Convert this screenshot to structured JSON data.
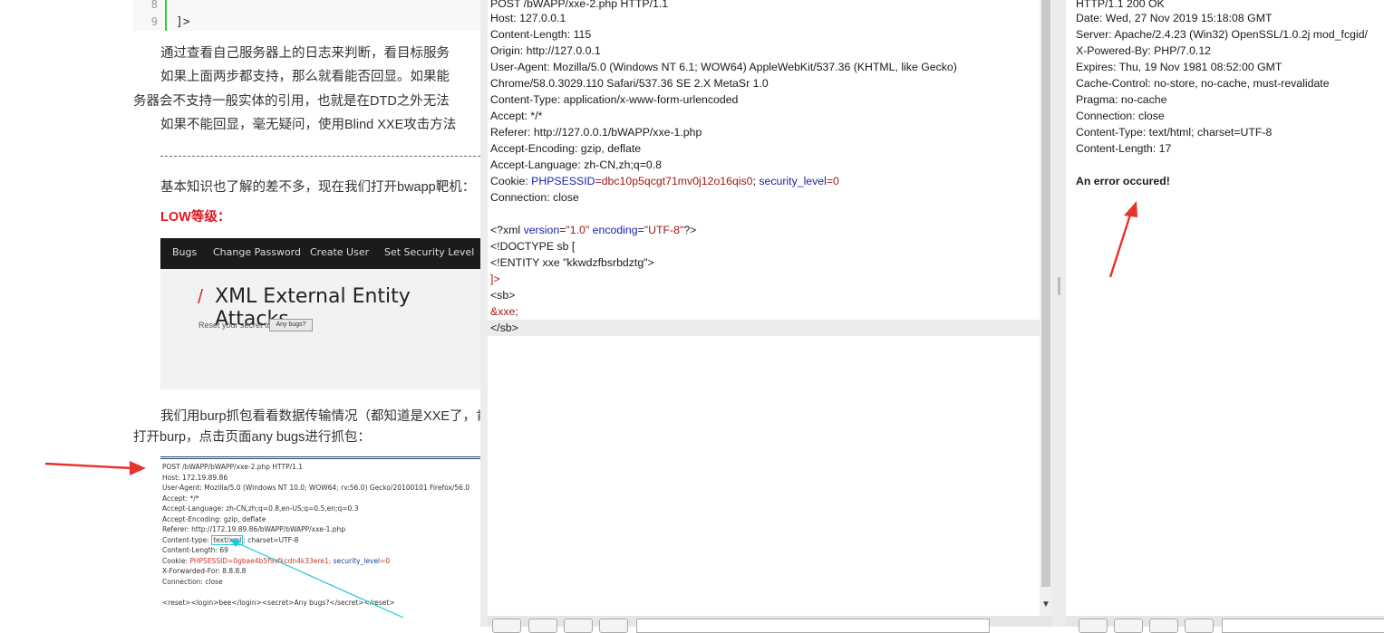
{
  "article": {
    "code_lines": [
      {
        "no": "8",
        "text": ""
      },
      {
        "no": "9",
        "text": "]>"
      }
    ],
    "para1": "通过查看自己服务器上的日志来判断，看目标服务",
    "para2": "如果上面两步都支持，那么就看能否回显。如果能",
    "para3": "务器会不支持一般实体的引用，也就是在DTD之外无法",
    "para4": "如果不能回显，毫无疑问，使用Blind XXE攻击方法",
    "divider": "------------------------------------------------------------------------",
    "para5": "基本知识也了解的差不多，现在我们打开bwapp靶机：",
    "low_heading": "LOW等级：",
    "bwapp": {
      "nav": [
        "Bugs",
        "Change Password",
        "Create User",
        "Set Security Level"
      ],
      "title": "XML External Entity Attacks",
      "slash": "/",
      "reset_label": "Reset your secret to",
      "reset_button": "Any bugs?"
    },
    "para6": "我们用burp抓包看看数据传输情况（都知道是XXE了，肯",
    "para7": "打开burp，点击页面any bugs进行抓包：",
    "capture": {
      "line1": "POST /bWAPP/bWAPP/xxe-2.php HTTP/1.1",
      "line2": "Host: 172.19.89.86",
      "line3": "User-Agent: Mozilla/5.0 (Windows NT 10.0; WOW64; rv:56.0) Gecko/20100101 Firefox/56.0",
      "line4": "Accept: */*",
      "line5": "Accept-Language: zh-CN,zh;q=0.8,en-US;q=0.5,en;q=0.3",
      "line6": "Accept-Encoding: gzip, deflate",
      "line7": "Referer: http://172.19.89.86/bWAPP/bWAPP/xxe-1.php",
      "line8_pre": "Content-type: ",
      "line8_box": "text/xml",
      "line8_post": "; charset=UTF-8",
      "line9": "Content-Length: 69",
      "line10_k": "Cookie: ",
      "line10_sess": "PHPSESSID",
      "line10_val": "=0gbae4b5f9sfkcdn4k33ere1; ",
      "line10_sec": "security_level",
      "line10_sv": "=0",
      "line11": "X-Forwarded-For: 8.8.8.8",
      "line12": "Connection: close",
      "line13": "<reset><login>bee</login><secret>Any bugs?</secret></reset>"
    }
  },
  "request": {
    "lines": [
      "POST /bWAPP/xxe-2.php HTTP/1.1",
      "Host: 127.0.0.1",
      "Content-Length: 115",
      "Origin: http://127.0.0.1",
      "User-Agent: Mozilla/5.0 (Windows NT 6.1; WOW64) AppleWebKit/537.36 (KHTML, like Gecko)",
      "Chrome/58.0.3029.110 Safari/537.36 SE 2.X MetaSr 1.0",
      "Content-Type: application/x-www-form-urlencoded",
      "Accept: */*",
      "Referer: http://127.0.0.1/bWAPP/xxe-1.php",
      "Accept-Encoding: gzip, deflate",
      "Accept-Language: zh-CN,zh;q=0.8"
    ],
    "cookie_label": "Cookie: ",
    "cookie_key1": "PHPSESSID",
    "cookie_val1": "=dbc10p5qcgt71mv0j12o16qis0",
    "cookie_sep": "; ",
    "cookie_key2": "security_level",
    "cookie_val2": "=0",
    "connection": "Connection: close",
    "xml_decl_a": "<?xml ",
    "xml_decl_version": "version",
    "xml_decl_eq1": "=",
    "xml_decl_v": "\"1.0\"",
    "xml_decl_enc": " encoding",
    "xml_decl_eq2": "=",
    "xml_decl_e": "\"UTF-8\"",
    "xml_decl_end": "?>",
    "doctype": "<!DOCTYPE sb [",
    "entity": " <!ENTITY xxe  \"kkwdzfbsrbdztg\">",
    "close_bracket": " ]>",
    "sb_open": "<sb>",
    "entity_ref": "  &xxe;",
    "sb_close": "</sb>"
  },
  "response": {
    "lines": [
      "HTTP/1.1 200 OK",
      "Date: Wed, 27 Nov 2019 15:18:08 GMT",
      "Server: Apache/2.4.23 (Win32) OpenSSL/1.0.2j mod_fcgid/",
      "X-Powered-By: PHP/7.0.12",
      "Expires: Thu, 19 Nov 1981 08:52:00 GMT",
      "Cache-Control: no-store, no-cache, must-revalidate",
      "Pragma: no-cache",
      "Connection: close",
      "Content-Type: text/html; charset=UTF-8",
      "Content-Length: 17"
    ],
    "error": "An error occured!"
  },
  "colors": {
    "accent_red": "#e8322c",
    "xml_blue": "#1a24a8",
    "xml_red": "#a01818",
    "cyan_box": "#1cc8d8"
  }
}
